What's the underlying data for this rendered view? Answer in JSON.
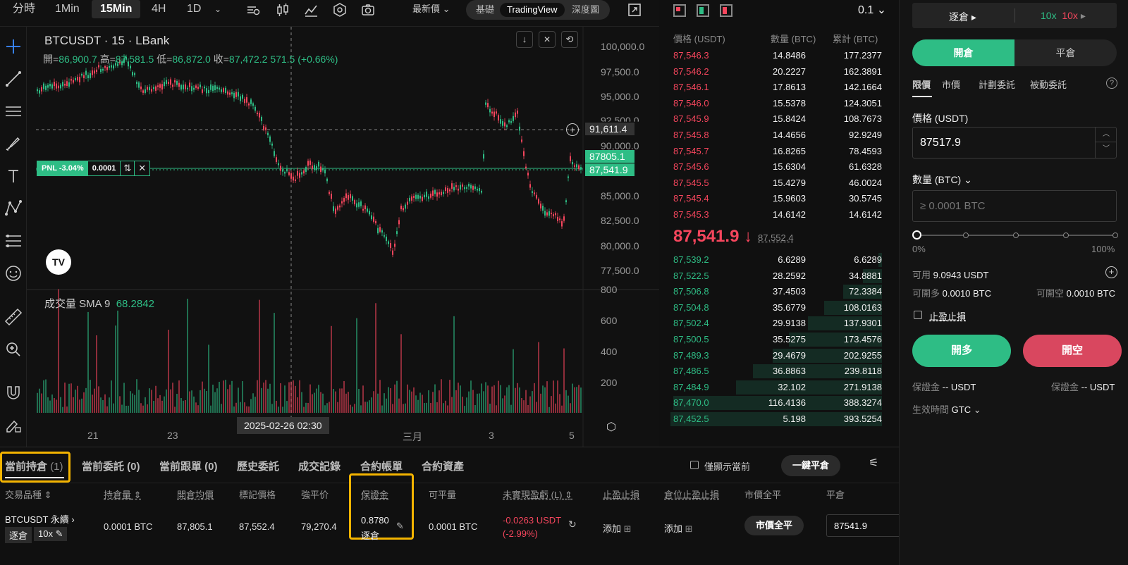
{
  "toolbar": {
    "intervals": [
      "分時",
      "1Min",
      "15Min",
      "4H",
      "1D"
    ],
    "active_interval": "15Min",
    "price_type": "最新價",
    "views": [
      "基礎",
      "TradingView",
      "深度圖"
    ],
    "active_view": "TradingView",
    "precision": "0.1"
  },
  "chart": {
    "title": "BTCUSDT · 15 · LBank",
    "open_label": "開=",
    "open": "86,900.7",
    "high_label": "高=",
    "high": "87,581.5",
    "low_label": "低=",
    "low": "86,872.0",
    "close_label": "收=",
    "close": "87,472.2",
    "change": "571.5 (+0.66%)",
    "y_ticks": [
      "100,000.0",
      "97,500.0",
      "95,000.0",
      "92,500.0",
      "90,000.0",
      "85,000.0",
      "82,500.0",
      "80,000.0",
      "77,500.0"
    ],
    "crosshair_price": "91,611.4",
    "entry_price_tag": "87805.1",
    "last_price_tag": "87,541.9",
    "pnl_label": "PNL -3.04%",
    "pnl_qty": "0.0001",
    "volume_label": "成交量 SMA 9",
    "volume_value": "68.2842",
    "vol_ticks": [
      "800",
      "600",
      "400",
      "200"
    ],
    "x_ticks": [
      "21",
      "23",
      "三月",
      "3",
      "5"
    ],
    "crosshair_time": "2025-02-26  02:30",
    "logo": "TV"
  },
  "orderbook": {
    "headers": [
      "價格 (USDT)",
      "數量 (BTC)",
      "累計 (BTC)"
    ],
    "asks": [
      [
        "87,546.3",
        "14.8486",
        "177.2377"
      ],
      [
        "87,546.2",
        "20.2227",
        "162.3891"
      ],
      [
        "87,546.1",
        "17.8613",
        "142.1664"
      ],
      [
        "87,546.0",
        "15.5378",
        "124.3051"
      ],
      [
        "87,545.9",
        "15.8424",
        "108.7673"
      ],
      [
        "87,545.8",
        "14.4656",
        "92.9249"
      ],
      [
        "87,545.7",
        "16.8265",
        "78.4593"
      ],
      [
        "87,545.6",
        "15.6304",
        "61.6328"
      ],
      [
        "87,545.5",
        "15.4279",
        "46.0024"
      ],
      [
        "87,545.4",
        "15.9603",
        "30.5745"
      ],
      [
        "87,545.3",
        "14.6142",
        "14.6142"
      ]
    ],
    "last_price": "87,541.9",
    "last_arrow": "↓",
    "mark_price": "87,552.4",
    "bids": [
      [
        "87,539.2",
        "6.6289",
        "6.6289"
      ],
      [
        "87,522.5",
        "28.2592",
        "34.8881"
      ],
      [
        "87,506.8",
        "37.4503",
        "72.3384"
      ],
      [
        "87,504.8",
        "35.6779",
        "108.0163"
      ],
      [
        "87,502.4",
        "29.9138",
        "137.9301"
      ],
      [
        "87,500.5",
        "35.5275",
        "173.4576"
      ],
      [
        "87,489.3",
        "29.4679",
        "202.9255"
      ],
      [
        "87,486.5",
        "36.8863",
        "239.8118"
      ],
      [
        "87,484.9",
        "32.102",
        "271.9138"
      ],
      [
        "87,470.0",
        "116.4136",
        "388.3274"
      ],
      [
        "87,452.5",
        "5.198",
        "393.5254"
      ]
    ],
    "bid_depth_fractions": [
      0.017,
      0.089,
      0.184,
      0.274,
      0.35,
      0.441,
      0.516,
      0.609,
      0.691,
      0.987,
      1.0
    ]
  },
  "panel": {
    "margin_mode": "逐倉",
    "lev_long": "10x",
    "lev_short": "10x",
    "open_tab": "開倉",
    "close_tab": "平倉",
    "order_types": [
      "限價",
      "市價",
      "計劃委託",
      "被動委託"
    ],
    "price_label": "價格 (USDT)",
    "price_value": "87517.9",
    "qty_label": "數量 (BTC)",
    "qty_placeholder": "≥ 0.0001 BTC",
    "slider_min": "0%",
    "slider_max": "100%",
    "available_label": "可用",
    "available_value": "9.0943 USDT",
    "can_long_label": "可開多",
    "can_long_value": "0.0010 BTC",
    "can_short_label": "可開空",
    "can_short_value": "0.0010 BTC",
    "tpsl_label": "止盈止損",
    "long_button": "開多",
    "short_button": "開空",
    "margin_long_label": "保證金",
    "margin_long_value": "-- USDT",
    "margin_short_label": "保證金",
    "margin_short_value": "-- USDT",
    "tif_label": "生效時間",
    "tif_value": "GTC"
  },
  "bottom": {
    "tabs": [
      "當前持倉",
      "當前委託 (0)",
      "當前跟單 (0)",
      "歷史委託",
      "成交記錄",
      "合約帳單",
      "合約資產"
    ],
    "position_count": "(1)",
    "only_current": "僅顯示當前",
    "close_all": "一鍵平倉",
    "headers": [
      "交易品種",
      "持倉量",
      "開倉均價",
      "標記價格",
      "強平价",
      "保證金",
      "可平量",
      "未實現盈虧 (L)",
      "止盈止損",
      "倉位止盈止損",
      "市價全平",
      "平倉"
    ],
    "row": {
      "symbol": "BTCUSDT 永續",
      "mode": "逐倉",
      "leverage": "10x",
      "size": "0.0001 BTC",
      "entry": "87,805.1",
      "mark": "87,552.4",
      "liq": "79,270.4",
      "margin": "0.8780",
      "margin_mode": "逐倉",
      "closable": "0.0001 BTC",
      "upnl": "-0.0263 USDT",
      "upnl_pct": "(-2.99%)",
      "tpsl_add": "添加",
      "pos_tpsl_add": "添加",
      "market_close": "市價全平",
      "close_price": "87541.9"
    }
  }
}
